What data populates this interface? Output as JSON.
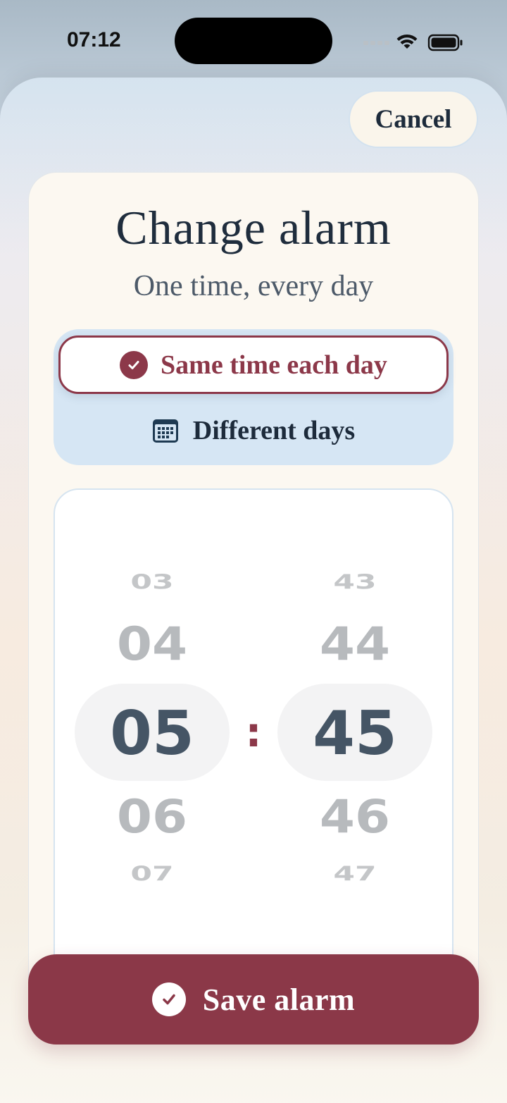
{
  "status": {
    "time": "07:12"
  },
  "header": {
    "cancel_label": "Cancel"
  },
  "card": {
    "title": "Change alarm",
    "subtitle": "One time, every day"
  },
  "modes": {
    "same_label": "Same time each day",
    "different_label": "Different days",
    "selected": "same"
  },
  "picker": {
    "hours": [
      "03",
      "04",
      "05",
      "06",
      "07"
    ],
    "minutes": [
      "43",
      "44",
      "45",
      "46",
      "47"
    ],
    "selected_hour": "05",
    "selected_minute": "45",
    "separator": ":"
  },
  "footer": {
    "save_label": "Save alarm"
  },
  "colors": {
    "accent": "#8b3848",
    "text": "#1f2d3d",
    "muted": "#b7babd"
  }
}
